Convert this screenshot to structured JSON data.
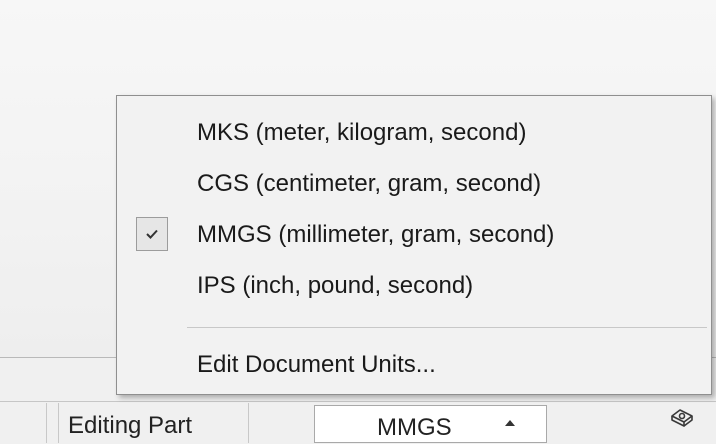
{
  "status_bar": {
    "mode_text": "Editing Part",
    "units_value": "MMGS",
    "units_arrow_icon": "triangle-up-icon",
    "rebuild_icon": "rebuild-icon"
  },
  "units_menu": {
    "items": [
      {
        "label": "MKS (meter, kilogram, second)",
        "checked": false
      },
      {
        "label": "CGS (centimeter, gram, second)",
        "checked": false
      },
      {
        "label": "MMGS (millimeter, gram, second)",
        "checked": true
      },
      {
        "label": "IPS (inch, pound, second)",
        "checked": false
      }
    ],
    "edit_units_label": "Edit Document Units...",
    "check_icon": "checkmark-icon"
  }
}
